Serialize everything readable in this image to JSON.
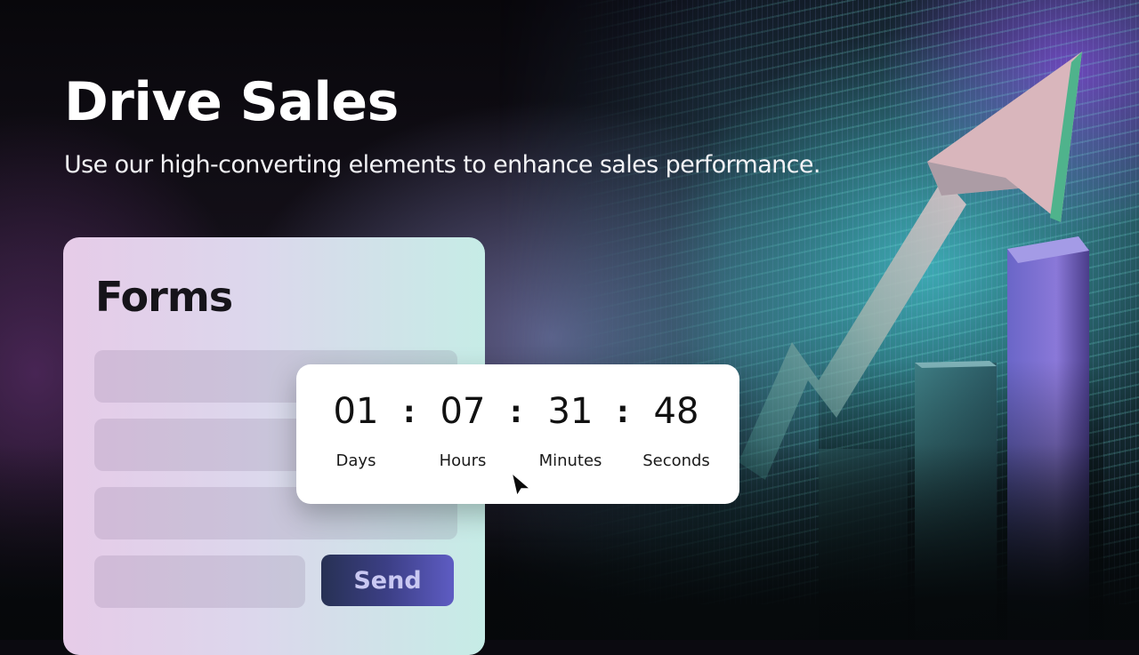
{
  "hero": {
    "title": "Drive Sales",
    "subtitle": "Use our high-converting elements to enhance sales performance."
  },
  "form_card": {
    "title": "Forms",
    "fields": [
      {
        "value": "",
        "placeholder": ""
      },
      {
        "value": "",
        "placeholder": ""
      },
      {
        "value": "",
        "placeholder": ""
      },
      {
        "value": "",
        "placeholder": ""
      }
    ],
    "send_label": "Send"
  },
  "countdown": {
    "separator": ":",
    "units": [
      {
        "value": "01",
        "label": "Days"
      },
      {
        "value": "07",
        "label": "Hours"
      },
      {
        "value": "31",
        "label": "Minutes"
      },
      {
        "value": "48",
        "label": "Seconds"
      }
    ]
  },
  "graphic": {
    "icon": "growth-chart-arrow-icon",
    "bars": 3
  },
  "colors": {
    "send_button_start": "#273154",
    "send_button_end": "#5e5cc3",
    "send_text": "#c9c8f2",
    "card_left": "#e6cbe8",
    "card_right": "#c6ece6"
  }
}
